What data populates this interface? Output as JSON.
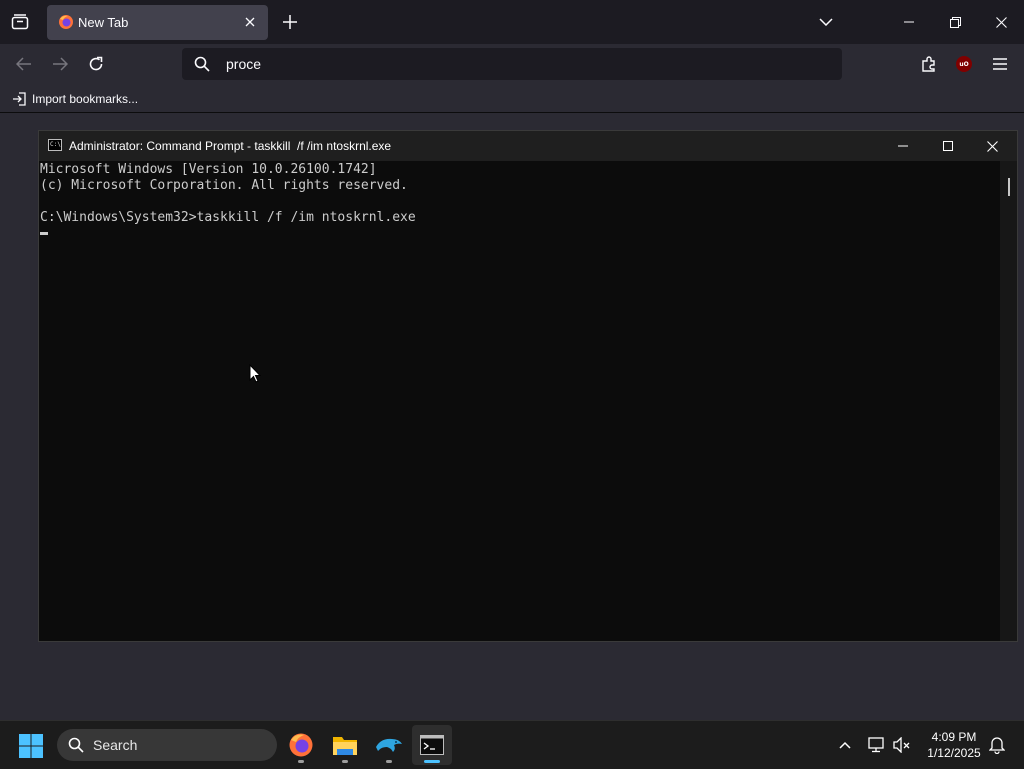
{
  "browser": {
    "tab": {
      "title": "New Tab"
    },
    "urlbar": {
      "value": "proce",
      "placeholder": ""
    },
    "bookmarks": {
      "import_label": "Import bookmarks..."
    }
  },
  "cmd": {
    "title": "Administrator: Command Prompt - taskkill  /f /im ntoskrnl.exe",
    "icon_text": "C:\\",
    "lines": [
      "Microsoft Windows [Version 10.0.26100.1742]",
      "(c) Microsoft Corporation. All rights reserved.",
      "",
      "C:\\Windows\\System32>taskkill /f /im ntoskrnl.exe"
    ]
  },
  "taskbar": {
    "search_placeholder": "Search",
    "apps": [
      "firefox-icon",
      "file-explorer-icon",
      "dolphin-icon",
      "terminal-icon"
    ],
    "clock": {
      "time": "4:09 PM",
      "date": "1/12/2025"
    }
  },
  "colors": {
    "accent": "#4cc2ff",
    "tab_bg": "#42414d",
    "toolbar_bg": "#2b2a33",
    "console_bg": "#0c0c0c",
    "console_text": "#cccccc"
  }
}
